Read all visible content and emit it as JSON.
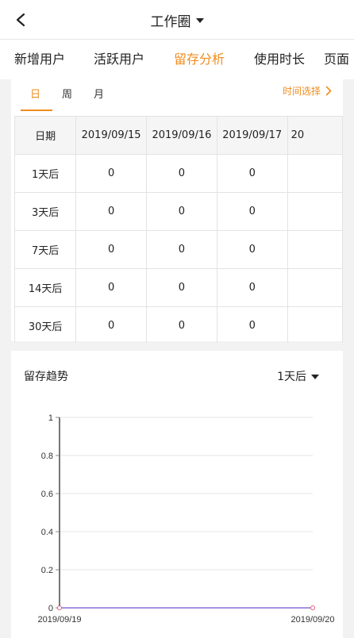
{
  "navbar": {
    "title": "工作圈"
  },
  "tabs": [
    {
      "label": "新增用户",
      "active": false
    },
    {
      "label": "活跃用户",
      "active": false
    },
    {
      "label": "留存分析",
      "active": true
    },
    {
      "label": "使用时长",
      "active": false
    },
    {
      "label": "页面",
      "active": false
    }
  ],
  "retention": {
    "period_tabs": [
      {
        "label": "日",
        "active": true
      },
      {
        "label": "周",
        "active": false
      },
      {
        "label": "月",
        "active": false
      }
    ],
    "time_select_label": "时间选择",
    "table": {
      "header": [
        "日期",
        "2019/09/15",
        "2019/09/16",
        "2019/09/17",
        "20"
      ],
      "rows": [
        [
          "1天后",
          "0",
          "0",
          "0",
          ""
        ],
        [
          "3天后",
          "0",
          "0",
          "0",
          ""
        ],
        [
          "7天后",
          "0",
          "0",
          "0",
          ""
        ],
        [
          "14天后",
          "0",
          "0",
          "0",
          ""
        ],
        [
          "30天后",
          "0",
          "0",
          "0",
          ""
        ]
      ]
    }
  },
  "trend": {
    "title": "留存趋势",
    "period_select": "1天后"
  },
  "chart_data": {
    "type": "line",
    "x": [
      "2019/09/19",
      "2019/09/20"
    ],
    "series": [
      {
        "values": [
          0,
          0
        ],
        "color": "#8a6fd8"
      }
    ],
    "ylim": [
      0,
      1
    ],
    "yticks": [
      "0",
      "0.2",
      "0.4",
      "0.6",
      "0.8",
      "1"
    ],
    "xticks": [
      "2019/09/19",
      "2019/09/20"
    ],
    "grid": true,
    "title": "",
    "xlabel": "",
    "ylabel": ""
  }
}
